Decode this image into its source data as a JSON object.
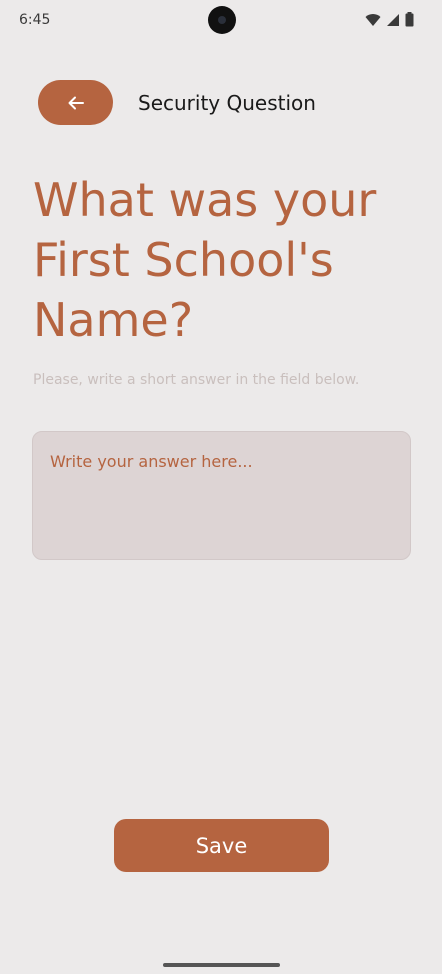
{
  "status_bar": {
    "time": "6:45",
    "icons": [
      "wifi-icon",
      "signal-icon",
      "battery-icon"
    ]
  },
  "header": {
    "back_icon": "arrow-left-icon",
    "title": "Security Question"
  },
  "question": {
    "line1": "What was your",
    "line2": "First School's",
    "line3": "Name?"
  },
  "helper_text": "Please, write a short answer in the field below.",
  "answer": {
    "value": "",
    "placeholder": "Write your answer here..."
  },
  "save_label": "Save",
  "colors": {
    "accent": "#B56440",
    "background": "#ECEAEA",
    "field_background": "#DDD4D4"
  }
}
